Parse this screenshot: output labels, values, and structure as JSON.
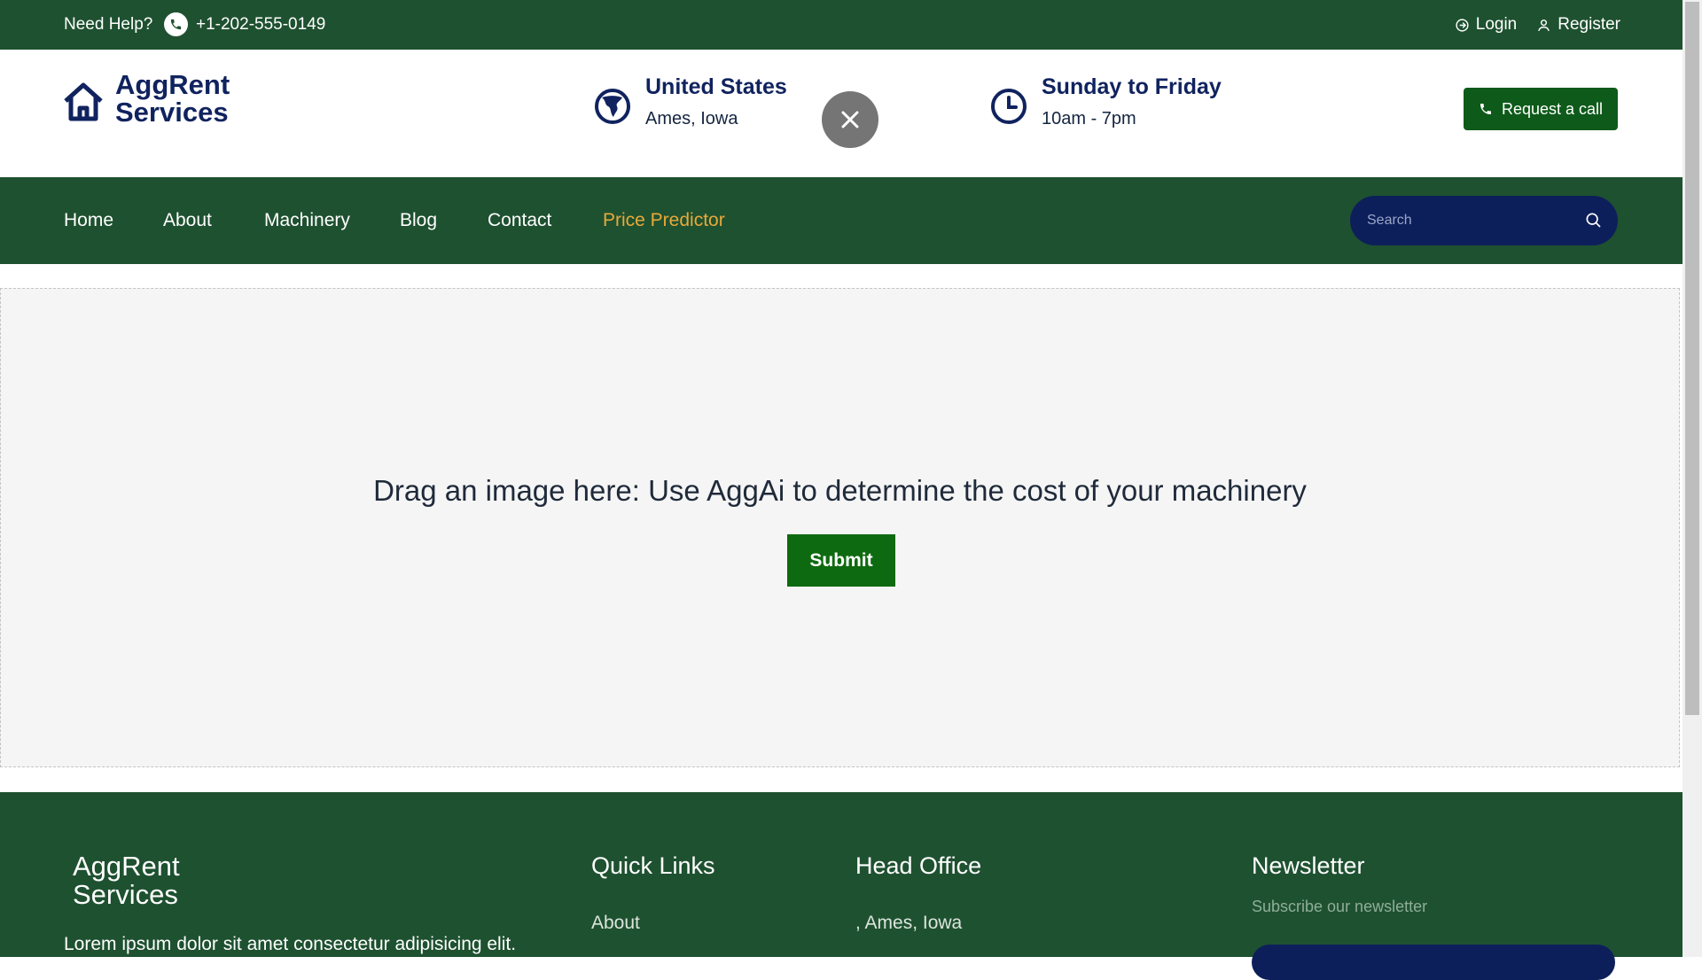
{
  "topbar": {
    "help_text": "Need Help?",
    "phone": "+1-202-555-0149",
    "login_label": "Login",
    "register_label": "Register"
  },
  "brand": {
    "name_line1": "AggRent",
    "name_line2": "Services"
  },
  "location": {
    "country": "United States",
    "city": "Ames, Iowa"
  },
  "hours": {
    "days": "Sunday to Friday",
    "time": "10am - 7pm"
  },
  "request_call_label": "Request a call",
  "nav": {
    "items": [
      {
        "label": "Home"
      },
      {
        "label": "About"
      },
      {
        "label": "Machinery"
      },
      {
        "label": "Blog"
      },
      {
        "label": "Contact"
      },
      {
        "label": "Price Predictor"
      }
    ],
    "active": "Price Predictor"
  },
  "search": {
    "placeholder": "Search"
  },
  "dropzone": {
    "prompt": "Drag an image here: Use AggAi to determine the cost of your machinery",
    "submit_label": "Submit"
  },
  "footer": {
    "brand_line1": "AggRent",
    "brand_line2": "Services",
    "description": "Lorem ipsum dolor sit amet consectetur adipisicing elit.",
    "quick_links": {
      "heading": "Quick Links",
      "first_link": "About"
    },
    "head_office": {
      "heading": "Head Office",
      "address": ", Ames, Iowa"
    },
    "newsletter": {
      "heading": "Newsletter",
      "subtext": "Subscribe our newsletter"
    }
  },
  "colors": {
    "primary_green": "#1e5130",
    "navy": "#10235f",
    "accent": "#e8a93a",
    "button_green": "#0e6a10"
  },
  "icons": [
    "phone-icon",
    "login-icon",
    "user-icon",
    "home-icon",
    "globe-icon",
    "clock-icon",
    "close-icon",
    "search-icon"
  ]
}
